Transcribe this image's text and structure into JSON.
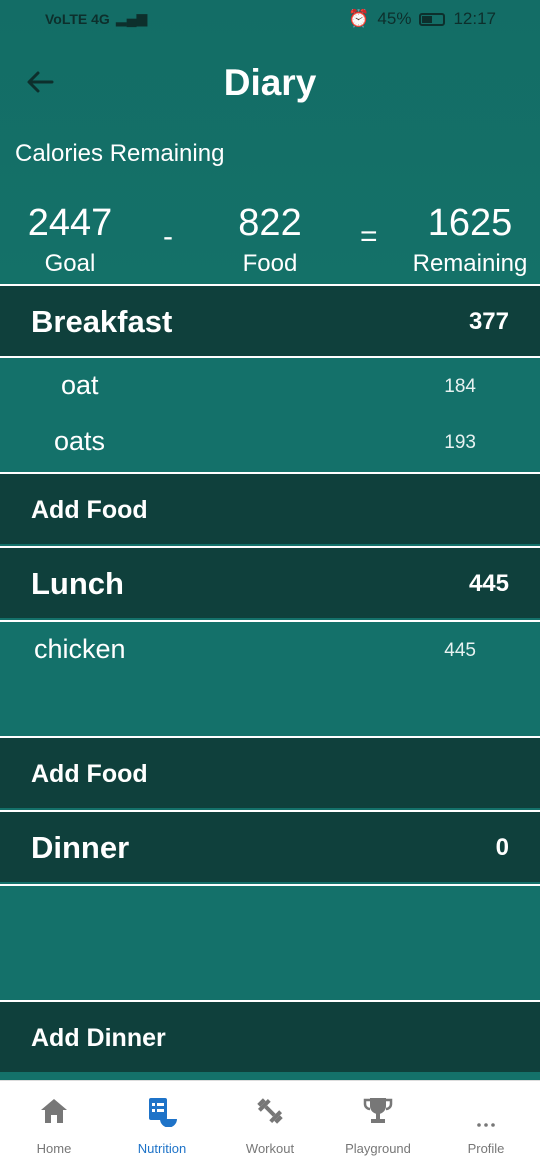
{
  "status": {
    "left_icons": "VoLTE 4G",
    "battery": "45%",
    "time": "12:17"
  },
  "header": {
    "title": "Diary"
  },
  "calories": {
    "label": "Calories Remaining",
    "goal": "2447",
    "goal_label": "Goal",
    "minus": "-",
    "food": "822",
    "food_label": "Food",
    "equals": "=",
    "remaining": "1625",
    "remaining_label": "Remaining"
  },
  "meals": {
    "breakfast": {
      "name": "Breakfast",
      "calories": "377",
      "items": [
        {
          "name": "oat",
          "calories": "184"
        },
        {
          "name": "oats",
          "calories": "193"
        }
      ],
      "add_label": "Add Food"
    },
    "lunch": {
      "name": "Lunch",
      "calories": "445",
      "items": [
        {
          "name": "chicken",
          "calories": "445"
        }
      ],
      "add_label": "Add Food"
    },
    "dinner": {
      "name": "Dinner",
      "calories": "0",
      "items": [],
      "add_label": "Add Dinner"
    }
  },
  "nav": {
    "items": [
      {
        "label": "Home",
        "icon": "home-icon"
      },
      {
        "label": "Nutrition",
        "icon": "nutrition-icon"
      },
      {
        "label": "Workout",
        "icon": "dumbbell-icon"
      },
      {
        "label": "Playground",
        "icon": "trophy-icon"
      },
      {
        "label": "Profile",
        "icon": "more-icon"
      }
    ],
    "active_color": "#1e73c8",
    "inactive_color": "#777777"
  },
  "colors": {
    "background": "#14716a",
    "section": "#0f403c"
  }
}
